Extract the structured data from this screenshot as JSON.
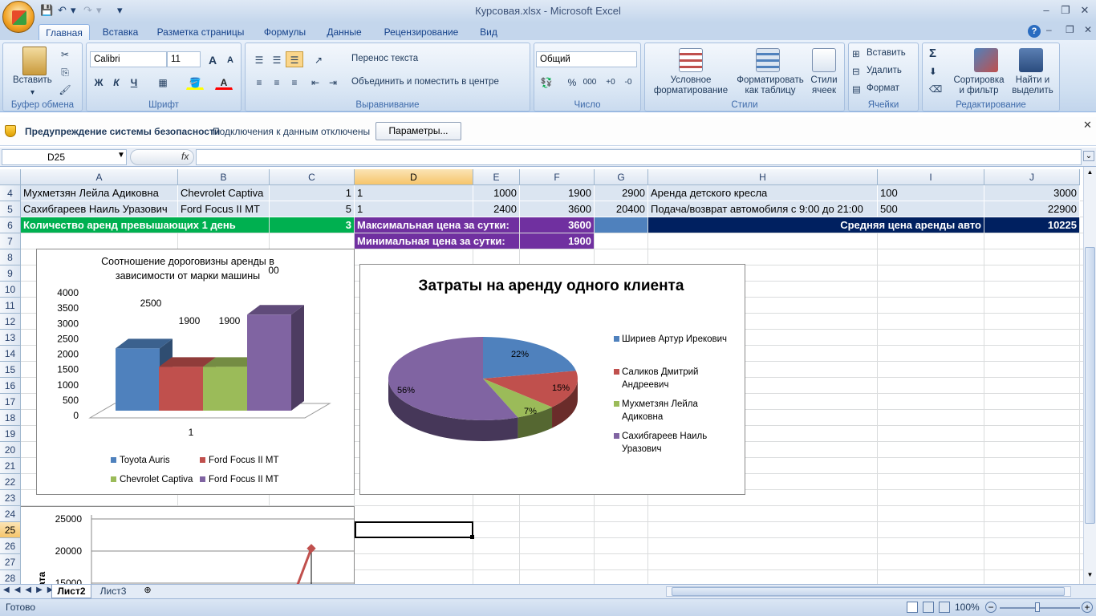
{
  "window": {
    "title": "Курсовая.xlsx - Microsoft Excel",
    "min_glyph": "–",
    "max_glyph": "❐",
    "close_glyph": "✕",
    "help_glyph": "?",
    "qat_more": "▾"
  },
  "tabs": [
    "Главная",
    "Вставка",
    "Разметка страницы",
    "Формулы",
    "Данные",
    "Рецензирование",
    "Вид"
  ],
  "ribbon": {
    "clipboard": {
      "label": "Буфер обмена",
      "paste": "Вставить"
    },
    "font": {
      "label": "Шрифт",
      "name": "Calibri",
      "size": "11",
      "bold": "Ж",
      "italic": "К",
      "underline": "Ч",
      "grow": "A",
      "shrink": "A"
    },
    "alignment": {
      "label": "Выравнивание",
      "wrap": "Перенос текста",
      "merge": "Объединить и поместить в центре"
    },
    "number": {
      "label": "Число",
      "format": "Общий",
      "percent": "%",
      "thousands": "000"
    },
    "styles": {
      "label": "Стили",
      "conditional": "Условное форматирование",
      "format_table": "Форматировать как таблицу",
      "cell_styles": "Стили ячеек"
    },
    "cells": {
      "label": "Ячейки",
      "insert": "Вставить",
      "delete": "Удалить",
      "format": "Формат"
    },
    "editing": {
      "label": "Редактирование",
      "sort": "Сортировка и фильтр",
      "find": "Найти и выделить",
      "sigma": "Σ"
    }
  },
  "security": {
    "title": "Предупреждение системы безопасности",
    "message": "Подключения к данным отключены",
    "button": "Параметры..."
  },
  "formula_bar": {
    "name_box": "D25",
    "fx": "fx",
    "formula": ""
  },
  "columns": [
    "A",
    "B",
    "C",
    "D",
    "E",
    "F",
    "G",
    "H",
    "I",
    "J"
  ],
  "rows": [
    "4",
    "5",
    "6",
    "7",
    "8",
    "9",
    "10",
    "11",
    "12",
    "13",
    "14",
    "15",
    "16",
    "17",
    "18",
    "19",
    "20",
    "21",
    "22",
    "23",
    "24",
    "25",
    "26",
    "27",
    "28"
  ],
  "cells": {
    "r4": {
      "A": "Мухметзян Лейла Адиковна",
      "B": "Chevrolet Captiva",
      "C": "1",
      "D": "1",
      "E": "1000",
      "F": "1900",
      "G": "2900",
      "H": "Аренда детского кресла",
      "I": "100",
      "J": "3000"
    },
    "r5": {
      "A": "Сахибгареев Наиль Уразович",
      "B": "Ford Focus II MT",
      "C": "5",
      "D": "1",
      "E": "2400",
      "F": "3600",
      "G": "20400",
      "H": "Подача/возврат автомобиля с 9:00 до 21:00",
      "I": "500",
      "J": "22900"
    },
    "r6": {
      "A": "Количество аренд превышающих 1 день",
      "C": "3",
      "D": "Максимальная цена за сутки:",
      "F": "3600",
      "H": "Средняя цена аренды авто",
      "J": "10225"
    },
    "r7": {
      "D": "Минимальная цена за сутки:",
      "F": "1900"
    }
  },
  "colors": {
    "green_fill": "#00b050",
    "purple_fill": "#7030a0",
    "navy_fill": "#002060",
    "blue_fill": "#4f81bd",
    "selected_header": "#f6c56b"
  },
  "chart_data": [
    {
      "type": "bar",
      "title": "Соотношение дороговизны аренды в зависимости от марки машины",
      "categories": [
        "1"
      ],
      "series": [
        {
          "name": "Toyota Auris",
          "values": [
            2500
          ],
          "color": "#4f81bd"
        },
        {
          "name": "Ford Focus II MT",
          "values": [
            1900
          ],
          "color": "#c0504d"
        },
        {
          "name": "Chevrolet Captiva",
          "values": [
            1900
          ],
          "color": "#9bbb59"
        },
        {
          "name": "Ford Focus II MT",
          "values": [
            3600
          ],
          "color": "#8064a2"
        }
      ],
      "data_labels": [
        "2500",
        "1900",
        "1900",
        "00"
      ],
      "yticks": [
        "0",
        "500",
        "1000",
        "1500",
        "2000",
        "2500",
        "3000",
        "3500",
        "4000"
      ],
      "ylim": [
        0,
        4000
      ],
      "legend": "bottom"
    },
    {
      "type": "pie",
      "title": "Затраты на аренду  одного клиента",
      "labels": [
        "Шириев Артур Ирекович",
        "Саликов Дмитрий Андреевич",
        "Мухметзян Лейла Адиковна",
        "Сахибгареев Наиль Уразович"
      ],
      "legend_lines": [
        [
          "Шириев Артур Ирекович"
        ],
        [
          "Саликов Дмитрий",
          "Андреевич"
        ],
        [
          "Мухметзян Лейла",
          "Адиковна"
        ],
        [
          "Сахибгареев Наиль",
          "Уразович"
        ]
      ],
      "values": [
        22,
        15,
        7,
        56
      ],
      "value_labels": [
        "22%",
        "15%",
        "7%",
        "56%"
      ],
      "colors": [
        "#4f81bd",
        "#c0504d",
        "#9bbb59",
        "#8064a2"
      ],
      "legend": "right"
    },
    {
      "type": "line",
      "yticks": [
        "15000",
        "20000",
        "25000"
      ],
      "ylabel": "ата",
      "visible_point": 20400
    }
  ],
  "sheets": [
    "Лист2",
    "Лист3"
  ],
  "status": {
    "ready": "Готово",
    "zoom": "100%"
  }
}
